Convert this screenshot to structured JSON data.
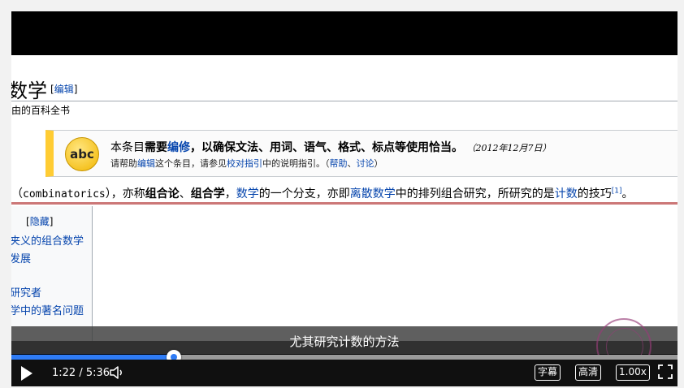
{
  "video": {
    "wiki": {
      "title": "数学",
      "edit_link": "编辑",
      "subtitle": "由的百科全书",
      "notice": {
        "badge": "abc",
        "main_pre": "本条目",
        "main_need": "需要",
        "main_edit": "编修",
        "main_post": "，以确保文法、用词、语气、格式、标点等使用恰当。",
        "date": "（2012年12月7日）",
        "sub_pre": "请帮助",
        "sub_edit": "编辑",
        "sub_mid": "这个条目，请参见",
        "sub_guide": "校对指引",
        "sub_mid2": "中的说明指引。（",
        "sub_help": "帮助",
        "sub_sep": "、",
        "sub_talk": "讨论",
        "sub_end": "）"
      },
      "body": {
        "p1": "（",
        "term": "combinatorics",
        "p2": "），亦称",
        "b1": "组合论",
        "p3": "、",
        "b2": "组合学",
        "p4": "，",
        "l1": "数学",
        "p5": "的一个分支，亦即",
        "l2": "离散数学",
        "p6": "中的排列组合研究，所研究的是",
        "l3": "计数",
        "p7": "的技巧",
        "ref": "[1]",
        "p8": "。"
      },
      "toc": {
        "hide_open": "[",
        "hide": "隐藏",
        "hide_close": "]",
        "items": [
          "夹义的组合数学",
          "发展",
          "研究者",
          "学中的著名问题"
        ]
      }
    },
    "caption": "尤其研究计数的方法"
  },
  "controls": {
    "time": "1:22 / 5:36",
    "progress": 0.244,
    "subtitles_label": "字幕",
    "quality_label": "高清",
    "speed_label": "1.00x"
  },
  "colors": {
    "accent": "#2f7cf6",
    "link": "#0645ad"
  },
  "icons": [
    "play-icon",
    "volume-icon",
    "fullscreen-icon"
  ]
}
